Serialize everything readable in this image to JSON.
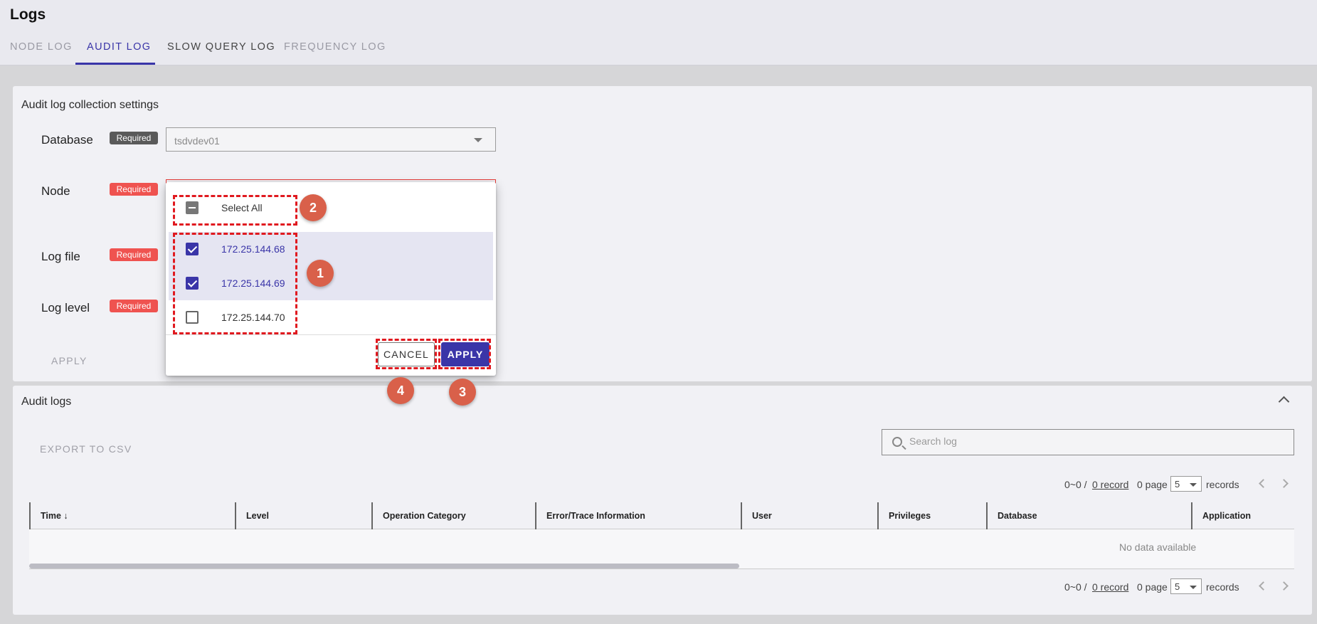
{
  "page": {
    "title": "Logs"
  },
  "tabs": [
    {
      "label": "NODE LOG",
      "active": false
    },
    {
      "label": "AUDIT LOG",
      "active": true
    },
    {
      "label": "SLOW QUERY LOG",
      "active": false
    },
    {
      "label": "FREQUENCY LOG",
      "active": false
    }
  ],
  "settings": {
    "title": "Audit log collection settings",
    "required_label": "Required",
    "database": {
      "label": "Database",
      "value": "tsdvdev01"
    },
    "node": {
      "label": "Node"
    },
    "log_file": {
      "label": "Log file"
    },
    "log_level": {
      "label": "Log level"
    },
    "apply_label": "APPLY"
  },
  "node_menu": {
    "select_all": "Select All",
    "options": [
      {
        "label": "172.25.144.68",
        "checked": true
      },
      {
        "label": "172.25.144.69",
        "checked": true
      },
      {
        "label": "172.25.144.70",
        "checked": false
      }
    ],
    "cancel_label": "CANCEL",
    "apply_label": "APPLY"
  },
  "annotations": [
    "1",
    "2",
    "3",
    "4"
  ],
  "audit_logs": {
    "title": "Audit logs",
    "export_label": "EXPORT TO CSV",
    "search_placeholder": "Search log",
    "pagination": {
      "range": "0~0 /",
      "record_link": "0 record",
      "page": "0 page",
      "per_page": "5",
      "records_label": "records"
    },
    "columns": [
      "Time ↓",
      "Level",
      "Operation Category",
      "Error/Trace Information",
      "User",
      "Privileges",
      "Database",
      "Application"
    ],
    "empty_text": "No data available"
  },
  "colors": {
    "accent": "#3a35a8",
    "required": "#ef5350",
    "highlight": "#e0191f",
    "marker": "#d9604a"
  }
}
